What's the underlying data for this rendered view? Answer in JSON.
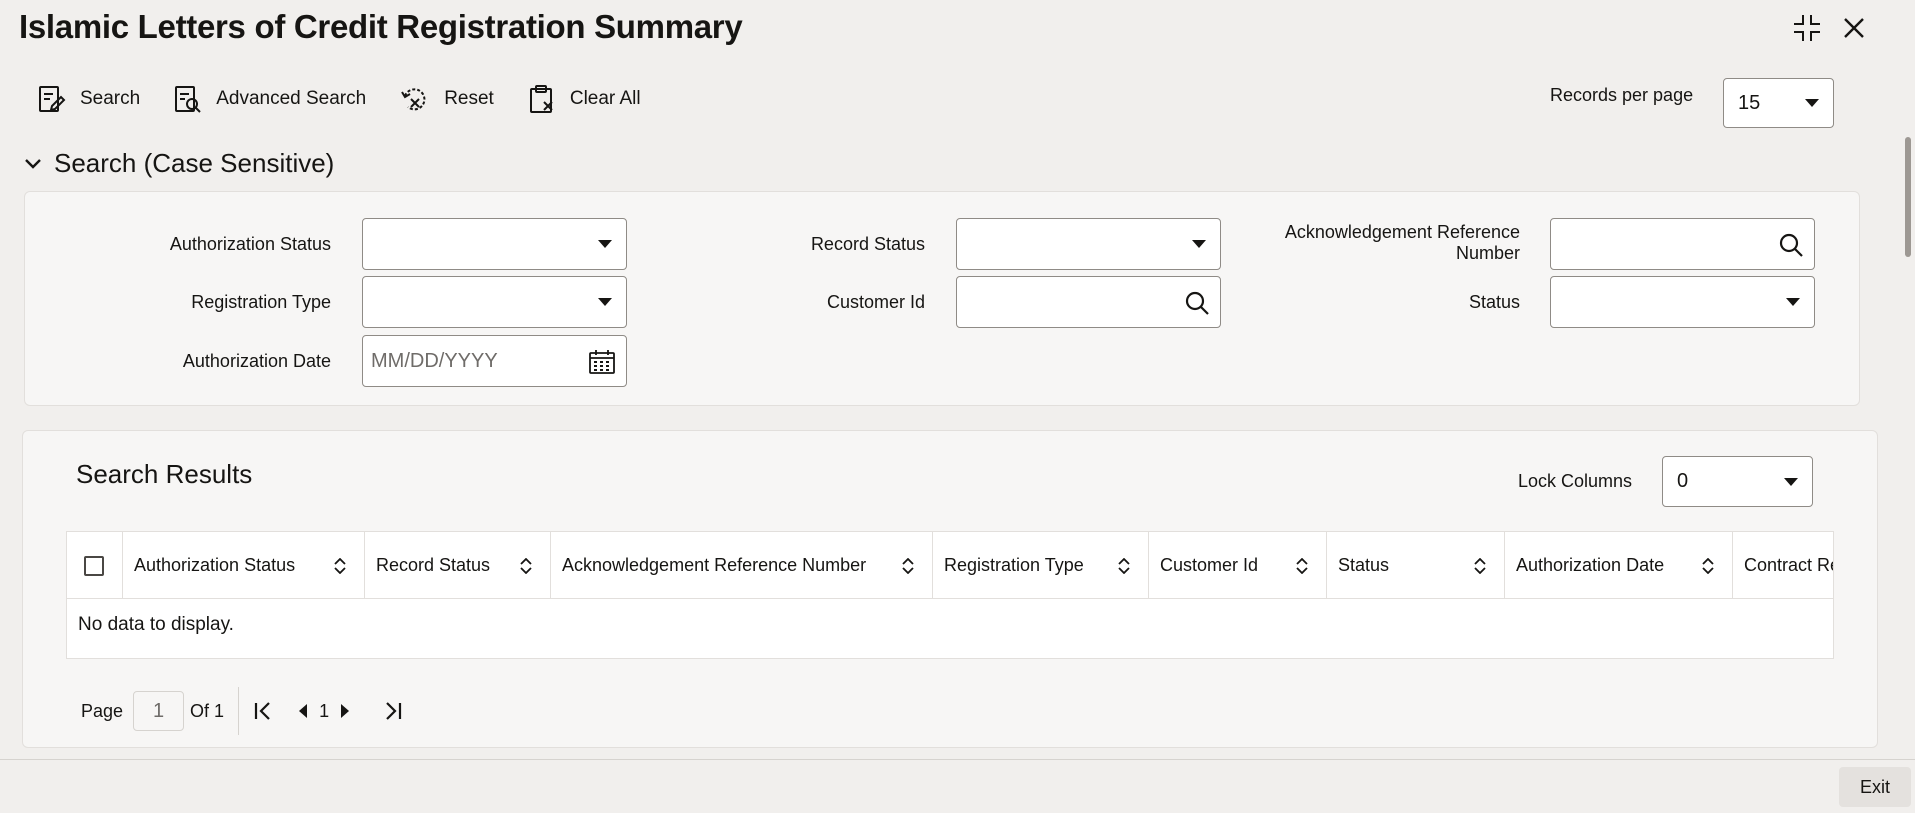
{
  "window": {
    "title": "Islamic Letters of Credit Registration Summary",
    "controls": [
      "minimize-icon",
      "close-icon"
    ]
  },
  "toolbar": {
    "search_label": "Search",
    "advanced_search_label": "Advanced Search",
    "reset_label": "Reset",
    "clear_all_label": "Clear All",
    "records_per_page_label": "Records per page",
    "records_per_page_value": "15"
  },
  "search_section": {
    "title": "Search (Case Sensitive)",
    "fields": {
      "authorization_status": {
        "label": "Authorization Status",
        "value": ""
      },
      "record_status": {
        "label": "Record Status",
        "value": ""
      },
      "ack_ref_label_line1": "Acknowledgement Reference",
      "ack_ref_label_line2": "Number",
      "ack_ref_value": "",
      "registration_type": {
        "label": "Registration Type",
        "value": ""
      },
      "customer_id": {
        "label": "Customer Id",
        "value": ""
      },
      "status": {
        "label": "Status",
        "value": ""
      },
      "authorization_date": {
        "label": "Authorization Date",
        "placeholder": "MM/DD/YYYY"
      }
    }
  },
  "results": {
    "title": "Search Results",
    "lock_columns_label": "Lock Columns",
    "lock_columns_value": "0",
    "columns": [
      "Authorization Status",
      "Record Status",
      "Acknowledgement Reference Number",
      "Registration Type",
      "Customer Id",
      "Status",
      "Authorization Date",
      "Contract Re"
    ],
    "empty_message": "No data to display."
  },
  "pager": {
    "page_label": "Page",
    "page_value": "1",
    "of_label": "Of 1",
    "current_page": "1"
  },
  "footer": {
    "exit_label": "Exit"
  }
}
